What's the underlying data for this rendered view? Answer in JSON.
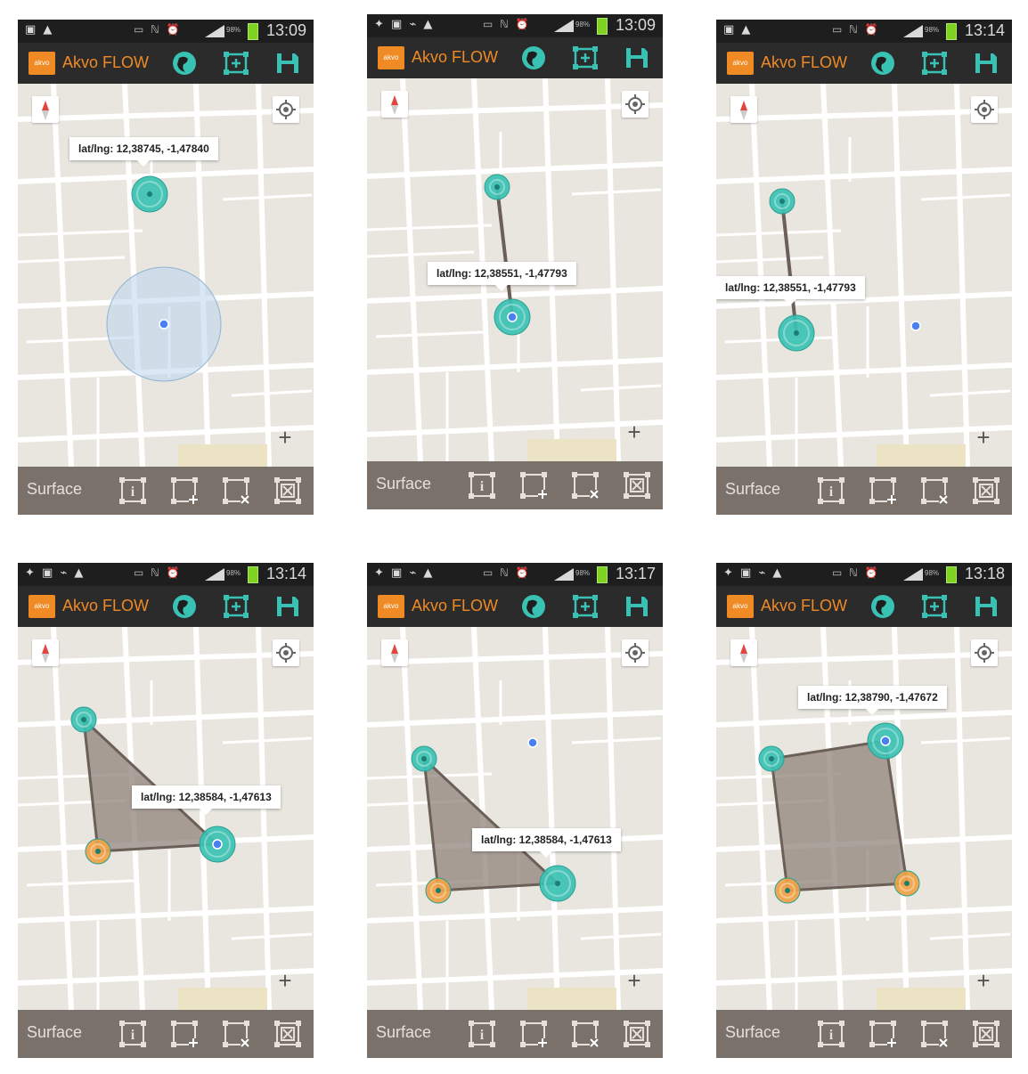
{
  "colors": {
    "teal": "#39c2b3",
    "orange": "#f0a244",
    "accent": "#f08a24",
    "blue_dot": "#4a7ff0",
    "polygon_fill": "#8f837b"
  },
  "icons": {
    "status_left": [
      "image-icon",
      "warning-icon",
      "gps-icon",
      "usb-icon"
    ],
    "status_right": [
      "vibrate-icon",
      "nfc-icon",
      "alarm-icon",
      "signal-icon",
      "battery-icon"
    ],
    "actionbar": [
      "globe-icon",
      "add-point-icon",
      "save-icon"
    ],
    "bottombar": [
      "info-shape-icon",
      "add-vertex-icon",
      "delete-vertex-icon",
      "clear-shape-icon"
    ],
    "map": [
      "compass-icon",
      "my-location-icon",
      "zoom-in-icon"
    ]
  },
  "screens": [
    {
      "status": {
        "left_icons": "▣ ▲",
        "right_icons": "▭ ℕ ⏰",
        "battery": "98%",
        "time": "13:09"
      },
      "appbar": {
        "logo": "akvo",
        "title": "Akvo FLOW"
      },
      "map": {
        "tooltip": "lat/lng: 12,38745, -1,47840",
        "zoom_label": "+"
      },
      "bottombar": {
        "label": "Surface"
      }
    },
    {
      "status": {
        "left_icons": "✦ ▣ ⌁ ▲",
        "right_icons": "▭ ℕ ⏰",
        "battery": "98%",
        "time": "13:09"
      },
      "appbar": {
        "logo": "akvo",
        "title": "Akvo FLOW"
      },
      "map": {
        "tooltip": "lat/lng: 12,38551, -1,47793",
        "zoom_label": "+"
      },
      "bottombar": {
        "label": "Surface"
      }
    },
    {
      "status": {
        "left_icons": "▣ ▲",
        "right_icons": "▭ ℕ ⏰",
        "battery": "98%",
        "time": "13:14"
      },
      "appbar": {
        "logo": "akvo",
        "title": "Akvo FLOW"
      },
      "map": {
        "tooltip": "lat/lng: 12,38551, -1,47793",
        "zoom_label": "+"
      },
      "bottombar": {
        "label": "Surface"
      }
    },
    {
      "status": {
        "left_icons": "✦ ▣ ⌁ ▲",
        "right_icons": "▭ ℕ ⏰",
        "battery": "98%",
        "time": "13:14"
      },
      "appbar": {
        "logo": "akvo",
        "title": "Akvo FLOW"
      },
      "map": {
        "tooltip": "lat/lng: 12,38584, -1,47613",
        "zoom_label": "+"
      },
      "bottombar": {
        "label": "Surface"
      }
    },
    {
      "status": {
        "left_icons": "✦ ▣ ⌁ ▲",
        "right_icons": "▭ ℕ ⏰",
        "battery": "98%",
        "time": "13:17"
      },
      "appbar": {
        "logo": "akvo",
        "title": "Akvo FLOW"
      },
      "map": {
        "tooltip": "lat/lng: 12,38584, -1,47613",
        "zoom_label": "+"
      },
      "bottombar": {
        "label": "Surface"
      }
    },
    {
      "status": {
        "left_icons": "✦ ▣ ⌁ ▲",
        "right_icons": "▭ ℕ ⏰",
        "battery": "98%",
        "time": "13:18"
      },
      "appbar": {
        "logo": "akvo",
        "title": "Akvo FLOW"
      },
      "map": {
        "tooltip": "lat/lng: 12,38790, -1,47672",
        "zoom_label": "+"
      },
      "bottombar": {
        "label": "Surface"
      }
    }
  ]
}
